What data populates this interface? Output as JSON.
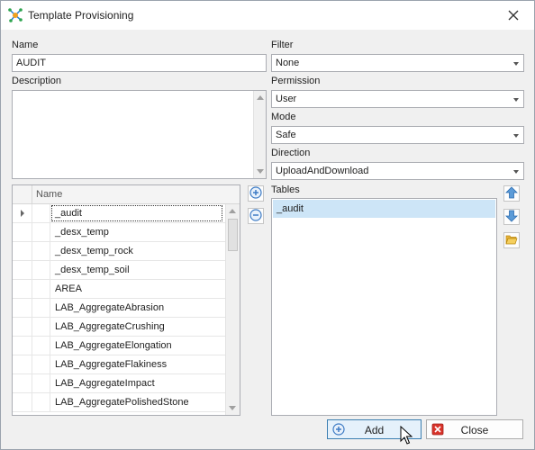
{
  "window": {
    "title": "Template Provisioning",
    "icon": "network-node-icon",
    "close": "close-icon"
  },
  "left": {
    "name_label": "Name",
    "name_value": "AUDIT",
    "description_label": "Description",
    "description_value": ""
  },
  "right": {
    "filter_label": "Filter",
    "filter_value": "None",
    "permission_label": "Permission",
    "permission_value": "User",
    "mode_label": "Mode",
    "mode_value": "Safe",
    "direction_label": "Direction",
    "direction_value": "UploadAndDownload",
    "tables_label": "Tables",
    "tables": [
      "_audit"
    ]
  },
  "grid": {
    "column_header": "Name",
    "rows": [
      "_audit",
      "_desx_temp",
      "_desx_temp_rock",
      "_desx_temp_soil",
      "AREA",
      "LAB_AggregateAbrasion",
      "LAB_AggregateCrushing",
      "LAB_AggregateElongation",
      "LAB_AggregateFlakiness",
      "LAB_AggregateImpact",
      "LAB_AggregatePolishedStone"
    ]
  },
  "buttons": {
    "add": "Add",
    "close": "Close"
  },
  "colors": {
    "selection": "#cde5f7",
    "accent_blue": "#3c7fb1",
    "close_red": "#d9342b"
  }
}
